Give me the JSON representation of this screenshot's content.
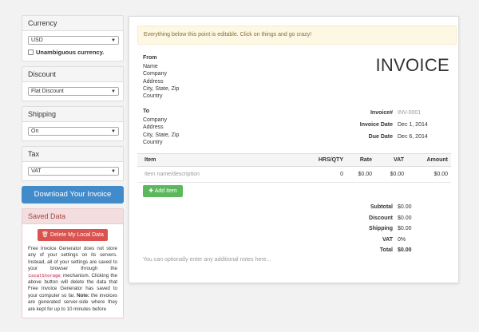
{
  "sidebar": {
    "currency": {
      "heading": "Currency",
      "selected": "USD",
      "unambiguous_label": "Unambiguous currency."
    },
    "discount": {
      "heading": "Discount",
      "selected": "Flat Discount"
    },
    "shipping": {
      "heading": "Shipping",
      "selected": "On"
    },
    "tax": {
      "heading": "Tax",
      "selected": "VAT"
    },
    "download_label": "Download Your Invoice",
    "saved": {
      "heading": "Saved Data",
      "delete_label": "Delete My Local Data",
      "text_1": "Free Invoice Generator does not store any of your settings on its servers. Instead, all of your settings are saved to your browser through the ",
      "code": "LocalStorage",
      "text_2": " mechanism. Clicking the above button will delete the data that Free Invoice Generator has saved to your computer so far. ",
      "note_label": "Note:",
      "text_3": " the invoices are generated server-side where they are kept for up to 10 minutes before"
    }
  },
  "invoice": {
    "alert": "Everything below this point is editable. Click on things and go crazy!",
    "title": "INVOICE",
    "from": {
      "label": "From",
      "lines": [
        "Name",
        "Company",
        "Address",
        "City, State, Zip",
        "Country"
      ]
    },
    "to": {
      "label": "To",
      "lines": [
        "Company",
        "Address",
        "City, State, Zip",
        "Country"
      ]
    },
    "meta": {
      "invoice_label": "Invoice#",
      "invoice_value": "INV-0001",
      "date_label": "Invoice Date",
      "date_value": "Dec 1, 2014",
      "due_label": "Due Date",
      "due_value": "Dec 6, 2014"
    },
    "table": {
      "headers": {
        "item": "Item",
        "hrs": "HRS/QTY",
        "rate": "Rate",
        "vat": "VAT",
        "amount": "Amount"
      },
      "row": {
        "item": "Item name/description",
        "hrs": "0",
        "rate": "$0.00",
        "vat": "$0.00",
        "amount": "$0.00"
      }
    },
    "add_item_label": "Add Item",
    "totals": {
      "subtotal_label": "Subtotal",
      "subtotal": "$0.00",
      "discount_label": "Discount",
      "discount": "$0.00",
      "shipping_label": "Shipping",
      "shipping": "$0.00",
      "vat_label": "VAT",
      "vat": "0%",
      "total_label": "Total",
      "total": "$0.00"
    },
    "notes_placeholder": "You can optionally enter any additional notes here..."
  }
}
